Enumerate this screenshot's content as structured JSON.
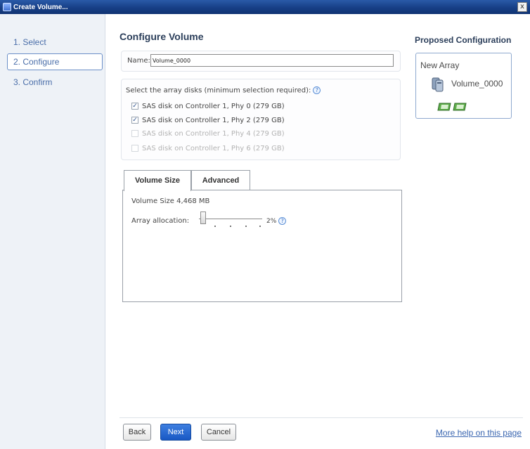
{
  "window": {
    "title": "Create Volume...",
    "close_glyph": "x"
  },
  "nav": {
    "items": [
      {
        "label": "1. Select"
      },
      {
        "label": "2. Configure"
      },
      {
        "label": "3. Confirm"
      }
    ]
  },
  "main": {
    "title": "Configure Volume",
    "name_label": "Name:",
    "name_value": "Volume_0000",
    "disks": {
      "prompt": "Select the array disks (minimum selection required):",
      "items": [
        {
          "label": "SAS disk on Controller 1, Phy 0 (279 GB)",
          "checked": true,
          "enabled": true
        },
        {
          "label": "SAS disk on Controller 1, Phy 2 (279 GB)",
          "checked": true,
          "enabled": true
        },
        {
          "label": "SAS disk on Controller 1, Phy 4 (279 GB)",
          "checked": false,
          "enabled": false
        },
        {
          "label": "SAS disk on Controller 1, Phy 6 (279 GB)",
          "checked": false,
          "enabled": false
        }
      ]
    },
    "tabs": [
      {
        "label": "Volume Size",
        "active": true
      },
      {
        "label": "Advanced",
        "active": false
      }
    ],
    "volume_size_text": "Volume Size 4,468 MB",
    "allocation_label": "Array allocation:",
    "allocation_value": "2%",
    "allocation_fraction": 0.02
  },
  "proposed": {
    "title": "Proposed Configuration",
    "array_label": "New Array",
    "volume_label": "Volume_0000"
  },
  "footer": {
    "back_label": "Back",
    "next_label": "Next",
    "cancel_label": "Cancel",
    "help_link": "More help on this page"
  },
  "icons": {
    "help": "help-icon",
    "volume": "volume-icon",
    "disk": "disk-icon"
  },
  "colors": {
    "accent": "#1958c4",
    "link": "#3a66b0",
    "title_bar": "#173f86"
  }
}
